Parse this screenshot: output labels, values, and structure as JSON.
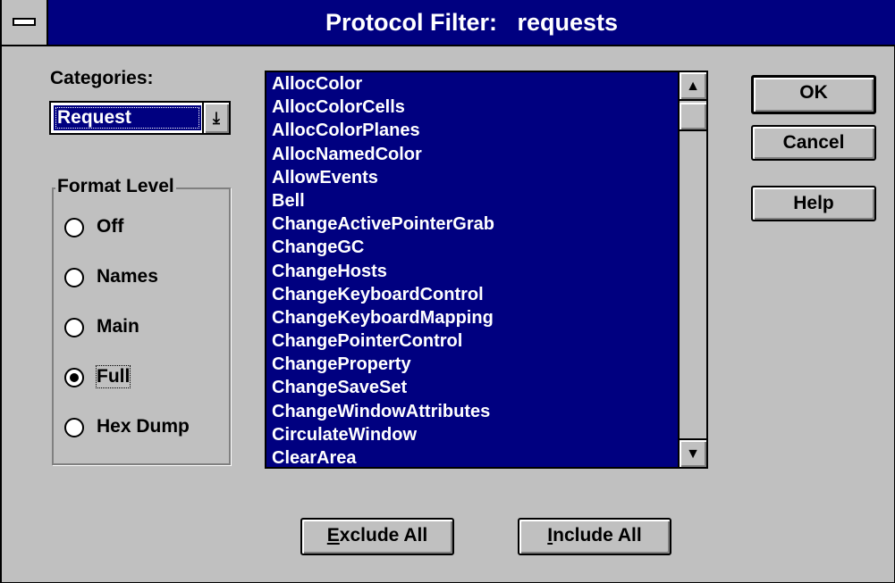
{
  "window": {
    "title": "Protocol Filter:   requests"
  },
  "categories": {
    "label": "Categories:",
    "value": "Request"
  },
  "format_level": {
    "title": "Format Level",
    "options": [
      {
        "label": "Off",
        "checked": false
      },
      {
        "label": "Names",
        "checked": false
      },
      {
        "label": "Main",
        "checked": false
      },
      {
        "label": "Full",
        "checked": true
      },
      {
        "label": "Hex Dump",
        "checked": false
      }
    ]
  },
  "list": {
    "items": [
      "AllocColor",
      "AllocColorCells",
      "AllocColorPlanes",
      "AllocNamedColor",
      "AllowEvents",
      "Bell",
      "ChangeActivePointerGrab",
      "ChangeGC",
      "ChangeHosts",
      "ChangeKeyboardControl",
      "ChangeKeyboardMapping",
      "ChangePointerControl",
      "ChangeProperty",
      "ChangeSaveSet",
      "ChangeWindowAttributes",
      "CirculateWindow",
      "ClearArea"
    ]
  },
  "buttons": {
    "ok": "OK",
    "cancel": "Cancel",
    "help": "Help",
    "exclude_all_mnemonic": "E",
    "exclude_all_rest": "xclude All",
    "include_all_mnemonic": "I",
    "include_all_rest": "nclude All"
  },
  "icons": {
    "system_menu": "system-menu-icon",
    "dropdown": "dropdown-arrow-icon",
    "scroll_up": "scroll-up-arrow-icon",
    "scroll_down": "scroll-down-arrow-icon"
  },
  "colors": {
    "title_bar": "#000080",
    "selection": "#000080",
    "face": "#c0c0c0"
  }
}
